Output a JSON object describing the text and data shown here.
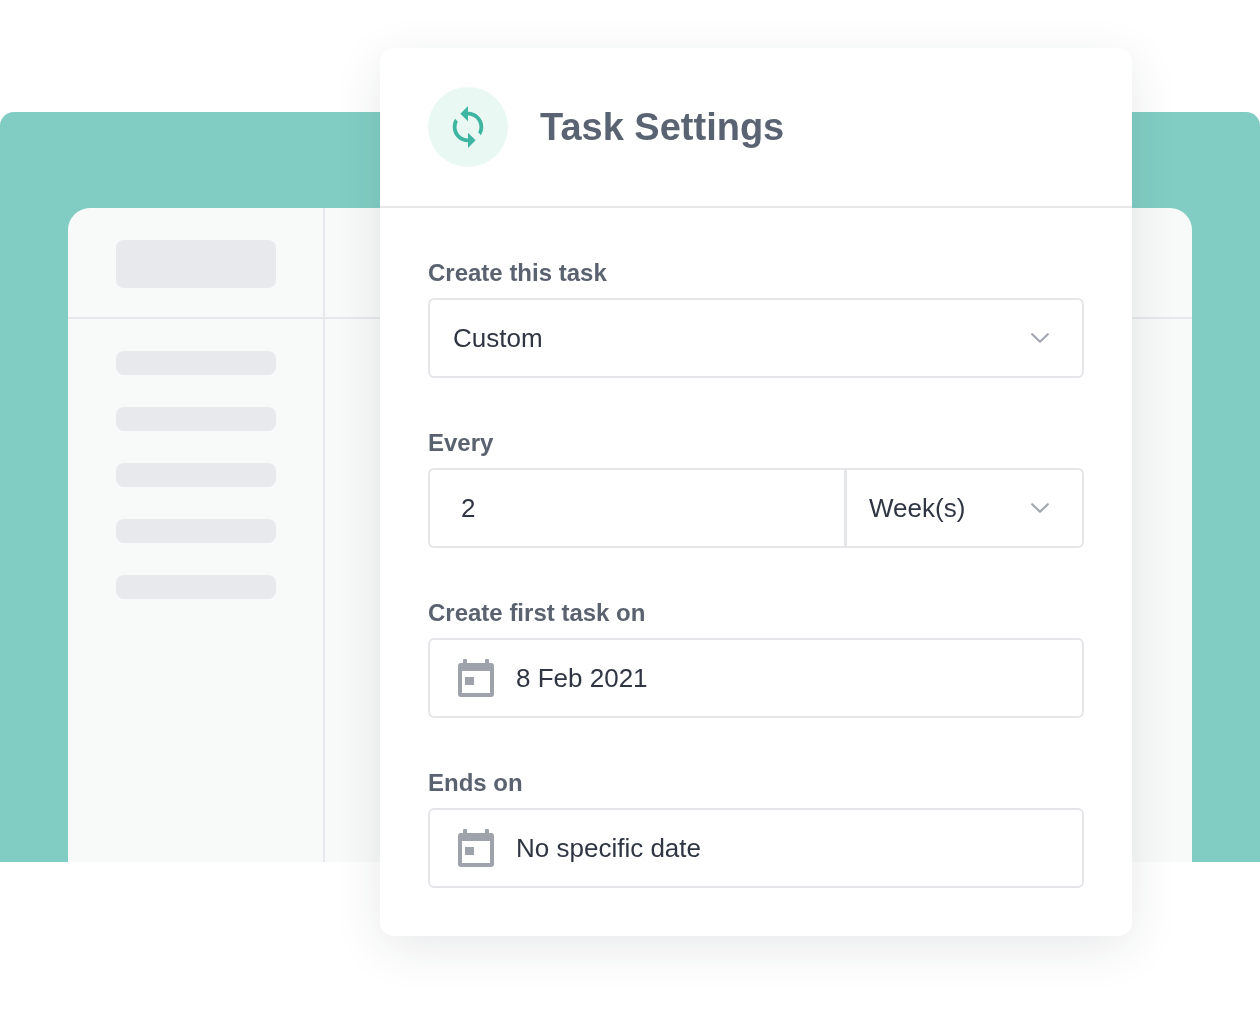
{
  "card": {
    "title": "Task Settings"
  },
  "fields": [
    {
      "kind": "select",
      "label": "Create this task",
      "value": "Custom"
    },
    {
      "kind": "number_unit",
      "label": "Every",
      "value": "2",
      "unit": "Week(s)"
    },
    {
      "kind": "date",
      "label": "Create first task on",
      "value": "8 Feb 2021"
    },
    {
      "kind": "date",
      "label": "Ends on",
      "value": "No specific date"
    }
  ]
}
